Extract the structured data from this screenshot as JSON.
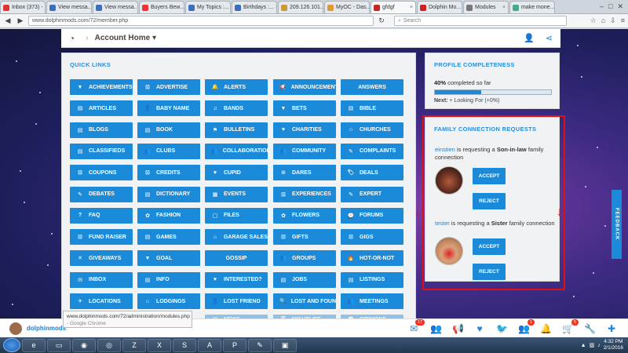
{
  "browser": {
    "tabs": [
      {
        "label": "Inbox (373) -",
        "color": "#d33",
        "active": false
      },
      {
        "label": "View messa...",
        "color": "#3b6fb8",
        "active": false
      },
      {
        "label": "View messa...",
        "color": "#3b6fb8",
        "active": false
      },
      {
        "label": "Buyers Bew...",
        "color": "#e33",
        "active": false
      },
      {
        "label": "My Topics :...",
        "color": "#3b6fb8",
        "active": false
      },
      {
        "label": "Birthdays :...",
        "color": "#3b6fb8",
        "active": false
      },
      {
        "label": "209.126.101...",
        "color": "#c93",
        "active": false
      },
      {
        "label": "MyOC - Das...",
        "color": "#d93",
        "active": false
      },
      {
        "label": "gfdgf",
        "color": "#c22",
        "active": true
      },
      {
        "label": "Dolphin Mo...",
        "color": "#c22",
        "active": false
      },
      {
        "label": "Modules",
        "color": "#777",
        "active": false
      },
      {
        "label": "make mone...",
        "color": "#4a8",
        "active": false
      }
    ],
    "url": "www.dolphinmods.com/72/member.php",
    "search_placeholder": "Search"
  },
  "topnav": {
    "title": "Account Home"
  },
  "quick_links": {
    "heading": "QUICK LINKS",
    "items": [
      [
        "ACHIEVEMENTS",
        "ADVERTISE",
        "ALERTS",
        "ANNOUNCEMENTS",
        "ANSWERS"
      ],
      [
        "ARTICLES",
        "BABY NAME",
        "BANDS",
        "BETS",
        "BIBLE"
      ],
      [
        "BLOGS",
        "BOOK",
        "BULLETINS",
        "CHARITIES",
        "CHURCHES"
      ],
      [
        "CLASSIFIEDS",
        "CLUBS",
        "COLLABORATIONS",
        "COMMUNITY",
        "COMPLAINTS"
      ],
      [
        "COUPONS",
        "CREDITS",
        "CUPID",
        "DARES",
        "DEALS"
      ],
      [
        "DEBATES",
        "DICTIONARY",
        "EVENTS",
        "EXPERIENCES",
        "EXPERT"
      ],
      [
        "FAQ",
        "FASHION",
        "FILES",
        "FLOWERS",
        "FORUMS"
      ],
      [
        "FUND RAISER",
        "GAMES",
        "GARAGE SALES",
        "GIFTS",
        "GIGS"
      ],
      [
        "GIVEAWAYS",
        "GOAL",
        "GOSSIP",
        "GROUPS",
        "HOT-OR-NOT"
      ],
      [
        "INBOX",
        "INFO",
        "INTERESTED?",
        "JOBS",
        "LISTINGS"
      ],
      [
        "LOCATIONS",
        "LODGINGS",
        "LOST FRIEND",
        "LOST AND FOUND",
        "MEETINGS"
      ],
      [
        "",
        "",
        "NEWS",
        "NIGHTLIFE",
        "OPINIONS"
      ]
    ],
    "icons": [
      [
        "▼",
        "⊡",
        "🔔",
        "📢",
        ""
      ],
      [
        "▤",
        "👤",
        "♫",
        "▼",
        "▤"
      ],
      [
        "▤",
        "▤",
        "⚑",
        "♥",
        "⌂"
      ],
      [
        "▤",
        "👥",
        "👥",
        "👥",
        "✎"
      ],
      [
        "⊡",
        "⊡",
        "♥",
        "⊙",
        "🏷"
      ],
      [
        "✎",
        "▤",
        "▦",
        "⊡",
        "✎"
      ],
      [
        "?",
        "✿",
        "▢",
        "✿",
        "💬"
      ],
      [
        "⊡",
        "▤",
        "⌂",
        "⊡",
        "⊡"
      ],
      [
        "✕",
        "▼",
        "",
        "👥",
        "🔥"
      ],
      [
        "✉",
        "▤",
        "♥",
        "▤",
        "▤"
      ],
      [
        "✈",
        "⌂",
        "👤",
        "🔍",
        "👥"
      ],
      [
        "",
        "",
        "▤",
        "🍸",
        "💬"
      ]
    ]
  },
  "profile_completeness": {
    "heading": "PROFILE COMPLETENESS",
    "percent_label": "40%",
    "completed_text": " completed so far",
    "progress": 0.4,
    "next_label": "Next:",
    "next_text": " + Looking For (+0%)"
  },
  "family_requests": {
    "heading": "FAMILY CONNECTION REQUESTS",
    "requests": [
      {
        "user": "einstien",
        "text_a": " is requesting a ",
        "relation": "Son-in-law",
        "text_b": " family connection",
        "accept": "ACCEPT",
        "reject": "REJECT"
      },
      {
        "user": "tester",
        "text_a": " is requesting a ",
        "relation": "Sister",
        "text_b": " family connection",
        "accept": "ACCEPT",
        "reject": "REJECT"
      }
    ]
  },
  "feedback_tab": "FEEDBACK",
  "bottombar": {
    "user_name": "dolphinmods",
    "status_url": "www.dolphinmods.com/72/administration/modules.php",
    "status_sub": "- Google Chrome",
    "badges": {
      "mail": "17",
      "friends": "1",
      "cart": "5"
    }
  },
  "taskbar": {
    "time": "4:32 PM",
    "date": "2/1/2016"
  },
  "colors": {
    "accent": "#1b8ad9",
    "annotation": "#dd1111"
  }
}
